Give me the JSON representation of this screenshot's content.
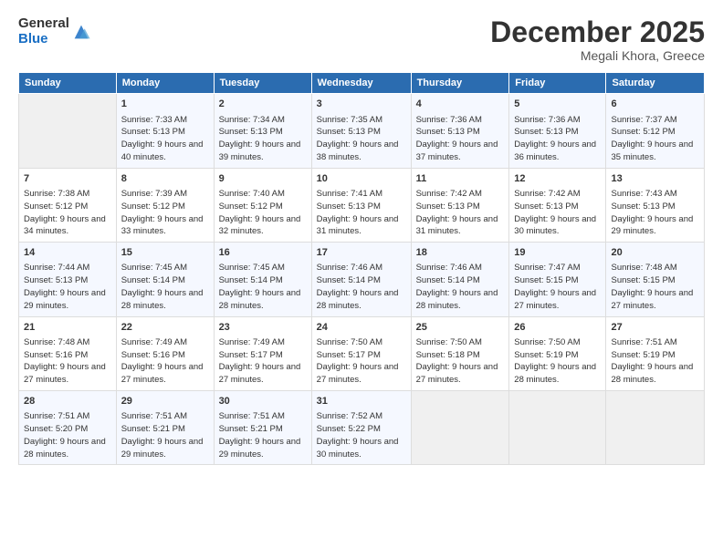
{
  "logo": {
    "general": "General",
    "blue": "Blue"
  },
  "title": "December 2025",
  "location": "Megali Khora, Greece",
  "days_of_week": [
    "Sunday",
    "Monday",
    "Tuesday",
    "Wednesday",
    "Thursday",
    "Friday",
    "Saturday"
  ],
  "weeks": [
    [
      {
        "day": "",
        "sunrise": "",
        "sunset": "",
        "daylight": ""
      },
      {
        "day": "1",
        "sunrise": "Sunrise: 7:33 AM",
        "sunset": "Sunset: 5:13 PM",
        "daylight": "Daylight: 9 hours and 40 minutes."
      },
      {
        "day": "2",
        "sunrise": "Sunrise: 7:34 AM",
        "sunset": "Sunset: 5:13 PM",
        "daylight": "Daylight: 9 hours and 39 minutes."
      },
      {
        "day": "3",
        "sunrise": "Sunrise: 7:35 AM",
        "sunset": "Sunset: 5:13 PM",
        "daylight": "Daylight: 9 hours and 38 minutes."
      },
      {
        "day": "4",
        "sunrise": "Sunrise: 7:36 AM",
        "sunset": "Sunset: 5:13 PM",
        "daylight": "Daylight: 9 hours and 37 minutes."
      },
      {
        "day": "5",
        "sunrise": "Sunrise: 7:36 AM",
        "sunset": "Sunset: 5:13 PM",
        "daylight": "Daylight: 9 hours and 36 minutes."
      },
      {
        "day": "6",
        "sunrise": "Sunrise: 7:37 AM",
        "sunset": "Sunset: 5:12 PM",
        "daylight": "Daylight: 9 hours and 35 minutes."
      }
    ],
    [
      {
        "day": "7",
        "sunrise": "Sunrise: 7:38 AM",
        "sunset": "Sunset: 5:12 PM",
        "daylight": "Daylight: 9 hours and 34 minutes."
      },
      {
        "day": "8",
        "sunrise": "Sunrise: 7:39 AM",
        "sunset": "Sunset: 5:12 PM",
        "daylight": "Daylight: 9 hours and 33 minutes."
      },
      {
        "day": "9",
        "sunrise": "Sunrise: 7:40 AM",
        "sunset": "Sunset: 5:12 PM",
        "daylight": "Daylight: 9 hours and 32 minutes."
      },
      {
        "day": "10",
        "sunrise": "Sunrise: 7:41 AM",
        "sunset": "Sunset: 5:13 PM",
        "daylight": "Daylight: 9 hours and 31 minutes."
      },
      {
        "day": "11",
        "sunrise": "Sunrise: 7:42 AM",
        "sunset": "Sunset: 5:13 PM",
        "daylight": "Daylight: 9 hours and 31 minutes."
      },
      {
        "day": "12",
        "sunrise": "Sunrise: 7:42 AM",
        "sunset": "Sunset: 5:13 PM",
        "daylight": "Daylight: 9 hours and 30 minutes."
      },
      {
        "day": "13",
        "sunrise": "Sunrise: 7:43 AM",
        "sunset": "Sunset: 5:13 PM",
        "daylight": "Daylight: 9 hours and 29 minutes."
      }
    ],
    [
      {
        "day": "14",
        "sunrise": "Sunrise: 7:44 AM",
        "sunset": "Sunset: 5:13 PM",
        "daylight": "Daylight: 9 hours and 29 minutes."
      },
      {
        "day": "15",
        "sunrise": "Sunrise: 7:45 AM",
        "sunset": "Sunset: 5:14 PM",
        "daylight": "Daylight: 9 hours and 28 minutes."
      },
      {
        "day": "16",
        "sunrise": "Sunrise: 7:45 AM",
        "sunset": "Sunset: 5:14 PM",
        "daylight": "Daylight: 9 hours and 28 minutes."
      },
      {
        "day": "17",
        "sunrise": "Sunrise: 7:46 AM",
        "sunset": "Sunset: 5:14 PM",
        "daylight": "Daylight: 9 hours and 28 minutes."
      },
      {
        "day": "18",
        "sunrise": "Sunrise: 7:46 AM",
        "sunset": "Sunset: 5:14 PM",
        "daylight": "Daylight: 9 hours and 28 minutes."
      },
      {
        "day": "19",
        "sunrise": "Sunrise: 7:47 AM",
        "sunset": "Sunset: 5:15 PM",
        "daylight": "Daylight: 9 hours and 27 minutes."
      },
      {
        "day": "20",
        "sunrise": "Sunrise: 7:48 AM",
        "sunset": "Sunset: 5:15 PM",
        "daylight": "Daylight: 9 hours and 27 minutes."
      }
    ],
    [
      {
        "day": "21",
        "sunrise": "Sunrise: 7:48 AM",
        "sunset": "Sunset: 5:16 PM",
        "daylight": "Daylight: 9 hours and 27 minutes."
      },
      {
        "day": "22",
        "sunrise": "Sunrise: 7:49 AM",
        "sunset": "Sunset: 5:16 PM",
        "daylight": "Daylight: 9 hours and 27 minutes."
      },
      {
        "day": "23",
        "sunrise": "Sunrise: 7:49 AM",
        "sunset": "Sunset: 5:17 PM",
        "daylight": "Daylight: 9 hours and 27 minutes."
      },
      {
        "day": "24",
        "sunrise": "Sunrise: 7:50 AM",
        "sunset": "Sunset: 5:17 PM",
        "daylight": "Daylight: 9 hours and 27 minutes."
      },
      {
        "day": "25",
        "sunrise": "Sunrise: 7:50 AM",
        "sunset": "Sunset: 5:18 PM",
        "daylight": "Daylight: 9 hours and 27 minutes."
      },
      {
        "day": "26",
        "sunrise": "Sunrise: 7:50 AM",
        "sunset": "Sunset: 5:19 PM",
        "daylight": "Daylight: 9 hours and 28 minutes."
      },
      {
        "day": "27",
        "sunrise": "Sunrise: 7:51 AM",
        "sunset": "Sunset: 5:19 PM",
        "daylight": "Daylight: 9 hours and 28 minutes."
      }
    ],
    [
      {
        "day": "28",
        "sunrise": "Sunrise: 7:51 AM",
        "sunset": "Sunset: 5:20 PM",
        "daylight": "Daylight: 9 hours and 28 minutes."
      },
      {
        "day": "29",
        "sunrise": "Sunrise: 7:51 AM",
        "sunset": "Sunset: 5:21 PM",
        "daylight": "Daylight: 9 hours and 29 minutes."
      },
      {
        "day": "30",
        "sunrise": "Sunrise: 7:51 AM",
        "sunset": "Sunset: 5:21 PM",
        "daylight": "Daylight: 9 hours and 29 minutes."
      },
      {
        "day": "31",
        "sunrise": "Sunrise: 7:52 AM",
        "sunset": "Sunset: 5:22 PM",
        "daylight": "Daylight: 9 hours and 30 minutes."
      },
      {
        "day": "",
        "sunrise": "",
        "sunset": "",
        "daylight": ""
      },
      {
        "day": "",
        "sunrise": "",
        "sunset": "",
        "daylight": ""
      },
      {
        "day": "",
        "sunrise": "",
        "sunset": "",
        "daylight": ""
      }
    ]
  ]
}
